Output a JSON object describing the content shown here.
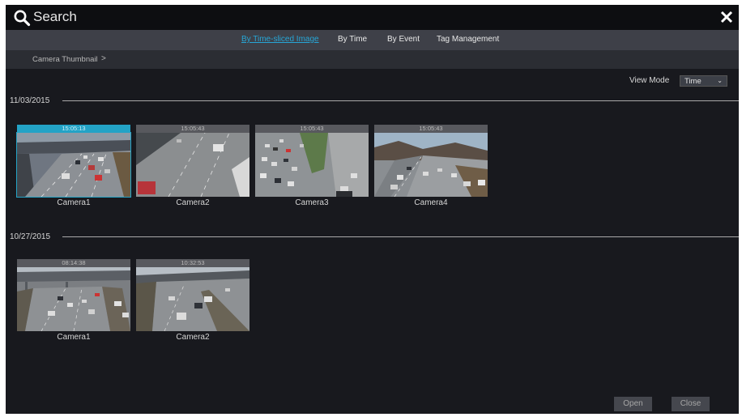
{
  "window": {
    "title": "Search",
    "search_icon": "search-icon",
    "close_icon": "close-icon"
  },
  "tabs": [
    {
      "label": "By Time-sliced Image",
      "active": true
    },
    {
      "label": "By Time",
      "active": false
    },
    {
      "label": "By Event",
      "active": false
    },
    {
      "label": "Tag Management",
      "active": false
    }
  ],
  "breadcrumb": {
    "label": "Camera Thumbnail",
    "separator": ">"
  },
  "view_mode": {
    "label": "View Mode",
    "value": "Time"
  },
  "groups": [
    {
      "date": "11/03/2015",
      "thumbnails": [
        {
          "time": "15:05:13",
          "camera": "Camera1",
          "selected": true
        },
        {
          "time": "15:05:43",
          "camera": "Camera2",
          "selected": false
        },
        {
          "time": "15:05:43",
          "camera": "Camera3",
          "selected": false
        },
        {
          "time": "15:05:43",
          "camera": "Camera4",
          "selected": false
        }
      ]
    },
    {
      "date": "10/27/2015",
      "thumbnails": [
        {
          "time": "08:14:38",
          "camera": "Camera1",
          "selected": false
        },
        {
          "time": "10:32:53",
          "camera": "Camera2",
          "selected": false
        }
      ]
    }
  ],
  "buttons": {
    "open": "Open",
    "close": "Close"
  },
  "colors": {
    "accent": "#23a3c6",
    "window_bg": "#18191e",
    "titlebar_bg": "#0d0e11",
    "tabbar_bg": "#3e4048"
  }
}
